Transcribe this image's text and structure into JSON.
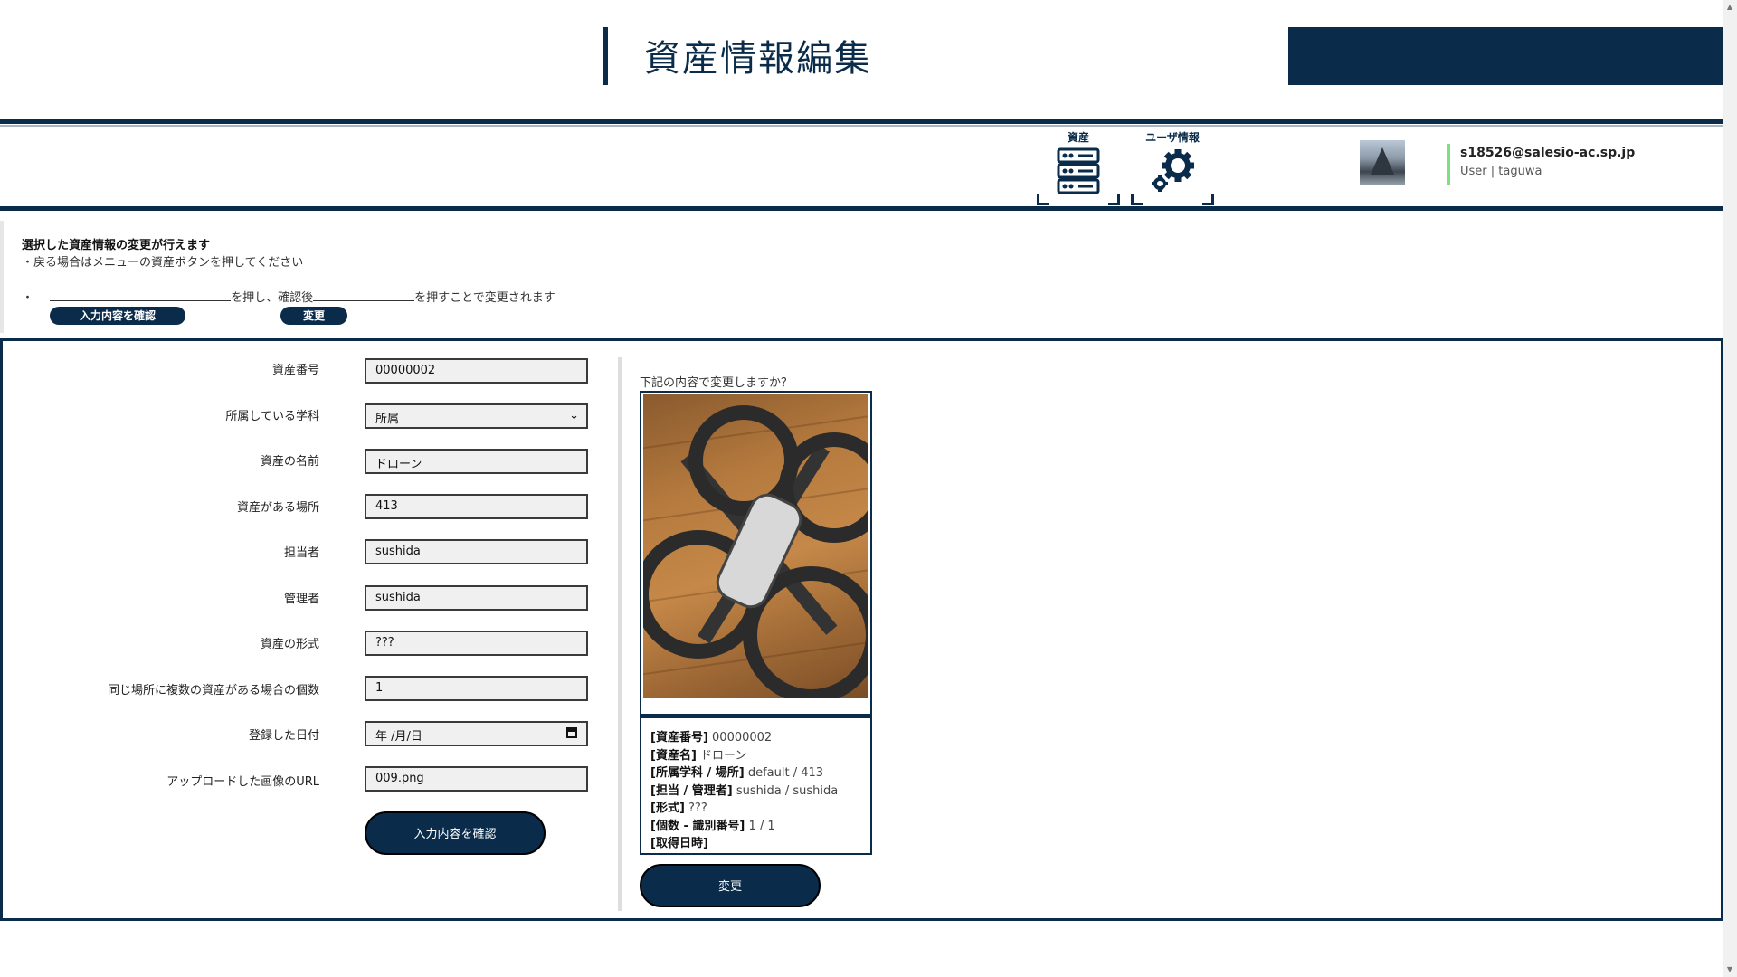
{
  "header": {
    "title": "資産情報編集"
  },
  "nav": {
    "items": [
      {
        "label": "資産",
        "icon": "server-icon"
      },
      {
        "label": "ユーザ情報",
        "icon": "gear-icon"
      }
    ]
  },
  "user": {
    "email": "s18526@salesio-ac.sp.jp",
    "role_line": "User | taguwa"
  },
  "instructions": {
    "title": "選択した資産情報の変更が行えます",
    "line1": "・戻る場合はメニューの資産ボタンを押してください",
    "bullet": "・",
    "part1": "を押し、確認後",
    "part2": "を押すことで変更されます",
    "confirm_label": "入力内容を確認",
    "change_label": "変更"
  },
  "form": {
    "fields": [
      {
        "label": "資産番号",
        "value": "00000002"
      },
      {
        "label": "所属している学科",
        "value": "所属"
      },
      {
        "label": "資産の名前",
        "value": "ドローン"
      },
      {
        "label": "資産がある場所",
        "value": "413"
      },
      {
        "label": "担当者",
        "value": "sushida"
      },
      {
        "label": "管理者",
        "value": "sushida"
      },
      {
        "label": "資産の形式",
        "value": "???"
      },
      {
        "label": "同じ場所に複数の資産がある場合の個数",
        "value": "1"
      },
      {
        "label": "登録した日付",
        "value": "年 /月/日"
      },
      {
        "label": "アップロードした画像のURL",
        "value": "009.png"
      }
    ],
    "confirm_button": "入力内容を確認"
  },
  "preview": {
    "question": "下記の内容で変更しますか？",
    "rows": [
      {
        "key": "[資産番号]",
        "value": "00000002"
      },
      {
        "key": "[資産名]",
        "value": "ドローン"
      },
      {
        "key": "[所属学科 / 場所]",
        "value": "default / 413"
      },
      {
        "key": "[担当 / 管理者]",
        "value": "sushida / sushida"
      },
      {
        "key": "[形式]",
        "value": "???"
      },
      {
        "key": "[個数 - 識別番号]",
        "value": "1 / 1"
      },
      {
        "key": "[取得日時]",
        "value": ""
      }
    ],
    "change_button": "変更"
  }
}
